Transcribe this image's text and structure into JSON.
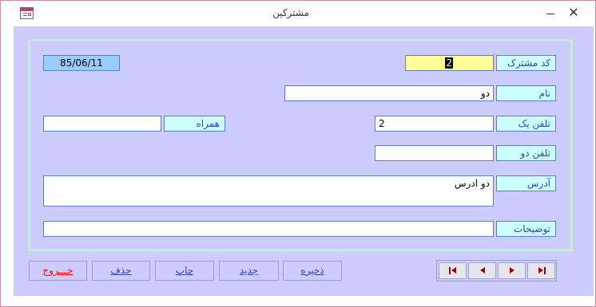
{
  "window": {
    "title": "مشترکین",
    "close_glyph": "✕"
  },
  "form": {
    "date": "85/06/11",
    "subscriber_code": {
      "label": "کد مشترک",
      "value": "2"
    },
    "name": {
      "label": "نام",
      "value": "دو"
    },
    "phone1": {
      "label": "تلفن یک",
      "value": "2"
    },
    "mobile": {
      "label": "همراه",
      "value": ""
    },
    "phone2": {
      "label": "تلفن دو",
      "value": ""
    },
    "address": {
      "label": "آدرس",
      "value": "دو ادرس"
    },
    "notes": {
      "label": "توضیحات",
      "value": ""
    }
  },
  "buttons": {
    "exit": "خـــروج",
    "delete": "حذف",
    "print": "چاپ",
    "new": "جدید",
    "save": "ذخیره"
  },
  "navigation": [
    "first-record",
    "previous-record",
    "next-record",
    "last-record"
  ],
  "colors": {
    "form_background": "#ccccff",
    "label_background": "#ccffff",
    "highlight_field": "#ffff99",
    "date_background": "#99ccff",
    "exit_text": "#ff0000"
  }
}
